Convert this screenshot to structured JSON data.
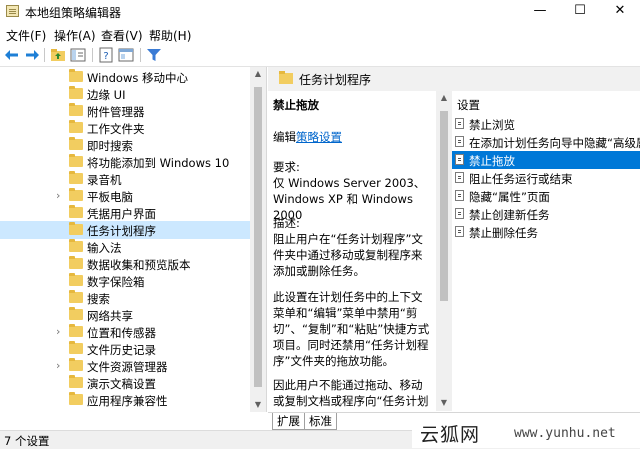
{
  "window": {
    "title": "本地组策略编辑器",
    "minimize_glyph": "—",
    "maximize_glyph": "☐",
    "close_glyph": "✕"
  },
  "menu": [
    "文件(F)",
    "操作(A)",
    "查看(V)",
    "帮助(H)"
  ],
  "toolbar": {
    "icons": [
      "back-arrow-icon",
      "forward-arrow-icon",
      "up-folder-icon",
      "show-hide-tree-icon",
      "help-icon",
      "properties-icon",
      "filter-icon"
    ],
    "colors": {
      "back": "#1e7fd6",
      "forward": "#1e7fd6",
      "filter": "#3a7bd5"
    }
  },
  "tree": {
    "items": [
      {
        "label": "Windows 移动中心",
        "expandable": false
      },
      {
        "label": "边缘 UI",
        "expandable": false
      },
      {
        "label": "附件管理器",
        "expandable": false
      },
      {
        "label": "工作文件夹",
        "expandable": false
      },
      {
        "label": "即时搜索",
        "expandable": false
      },
      {
        "label": "将功能添加到 Windows 10",
        "expandable": false
      },
      {
        "label": "录音机",
        "expandable": false
      },
      {
        "label": "平板电脑",
        "expandable": true
      },
      {
        "label": "凭据用户界面",
        "expandable": false
      },
      {
        "label": "任务计划程序",
        "expandable": false,
        "selected": true
      },
      {
        "label": "输入法",
        "expandable": false
      },
      {
        "label": "数据收集和预览版本",
        "expandable": false
      },
      {
        "label": "数字保险箱",
        "expandable": false
      },
      {
        "label": "搜索",
        "expandable": false
      },
      {
        "label": "网络共享",
        "expandable": false
      },
      {
        "label": "位置和传感器",
        "expandable": true
      },
      {
        "label": "文件历史记录",
        "expandable": false
      },
      {
        "label": "文件资源管理器",
        "expandable": true
      },
      {
        "label": "演示文稿设置",
        "expandable": false
      },
      {
        "label": "应用程序兼容性",
        "expandable": false
      }
    ],
    "expander_glyph": "›"
  },
  "right_header": {
    "title": "任务计划程序"
  },
  "description": {
    "policy_title": "禁止拖放",
    "edit_prefix": "编辑",
    "edit_link": "策略设置",
    "requirements": "要求:\n仅 Windows Server 2003、Windows XP 和 Windows 2000",
    "description_label": "描述:",
    "description_p1": "阻止用户在“任务计划程序”文件夹中通过移动或复制程序来添加或删除任务。",
    "description_p2": "此设置在计划任务中的上下文菜单和“编辑”菜单中禁用“剪切”、“复制”和“粘贴”快捷方式项目。同时还禁用“任务计划程序”文件夹的拖放功能。",
    "description_p3": "因此用户不能通过拖动、移动或复制文档或程序向“任务计划程序”文件夹添加新的计划任务"
  },
  "settings_list": {
    "column_header": "设置",
    "items": [
      {
        "label": "禁止浏览"
      },
      {
        "label": "在添加计划任务向导中隐藏“高级属性”"
      },
      {
        "label": "禁止拖放",
        "selected": true
      },
      {
        "label": "阻止任务运行或结束"
      },
      {
        "label": "隐藏“属性”页面"
      },
      {
        "label": "禁止创建新任务"
      },
      {
        "label": "禁止删除任务"
      }
    ],
    "selection_color": "#0078d7"
  },
  "tabs": [
    {
      "label": "扩展",
      "active": true
    },
    {
      "label": "标准",
      "active": false
    }
  ],
  "status": {
    "text": "7 个设置"
  },
  "watermark": {
    "text_cn": "云狐网",
    "url": "www.yunhu.net"
  }
}
